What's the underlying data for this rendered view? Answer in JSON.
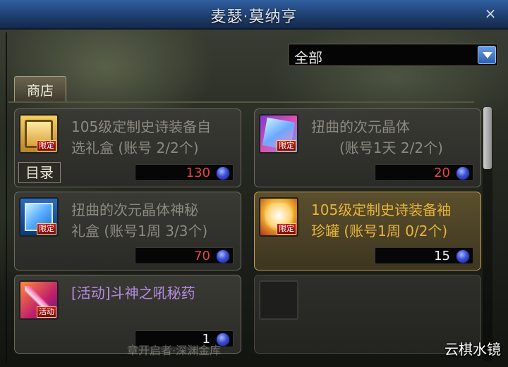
{
  "window": {
    "title": "麦瑟·莫纳亨",
    "close_label": "×"
  },
  "filter": {
    "selected": "全部"
  },
  "tab": {
    "label": "商店"
  },
  "catalog_label": "目录",
  "items": [
    {
      "name_line1": "105级定制史诗装备自",
      "name_line2": "选礼盒 (账号 2/2个)",
      "badge": "限定",
      "price": "130",
      "price_color": "#e94545",
      "icon": "golden-chest-icon"
    },
    {
      "name_line1": "扭曲的次元晶体",
      "name_line2": "    (账号1天 2/2个)",
      "badge": "限定",
      "price": "20",
      "price_color": "#e94545",
      "icon": "dimension-crystal-icon"
    },
    {
      "name_line1": "扭曲的次元晶体神秘",
      "name_line2": "礼盒 (账号1周 3/3个)",
      "badge": "限定",
      "price": "70",
      "price_color": "#e94545",
      "icon": "crystal-giftbox-icon"
    },
    {
      "name_line1": "105级定制史诗装备袖",
      "name_line2": "珍罐 (账号1周 0/2个)",
      "badge": "限定",
      "price": "15",
      "price_color": "#f2f2f2",
      "icon": "epic-jar-icon"
    },
    {
      "name_line1": "[活动]斗神之吼秘药",
      "name_line2": "",
      "badge": "活动",
      "price": "1",
      "price_color": "#f2f2f2",
      "icon": "potion-icon"
    }
  ],
  "background_text": "章开启者·深渊金库",
  "watermark": "云棋水镜"
}
